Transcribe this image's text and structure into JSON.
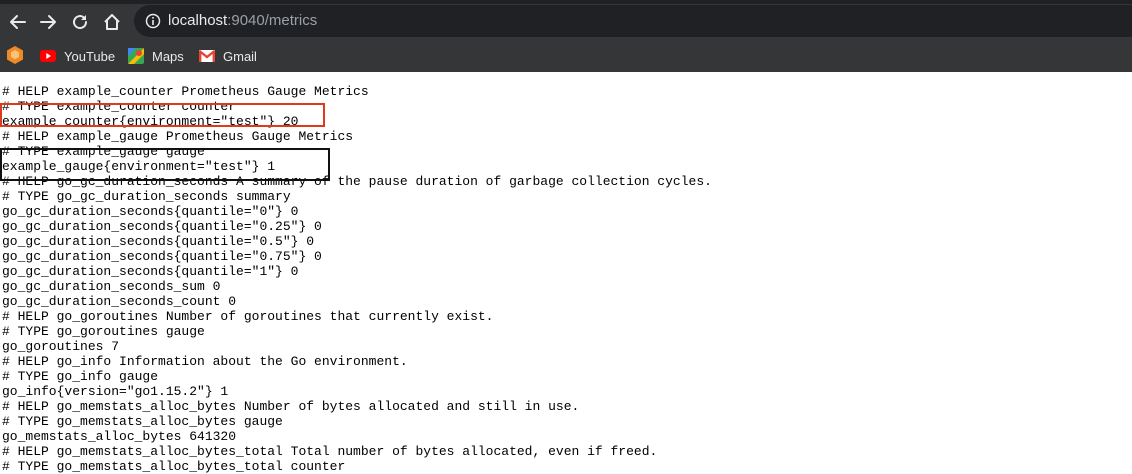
{
  "browser": {
    "url_host": "localhost",
    "url_rest": ":9040/metrics"
  },
  "bookmarks": [
    {
      "label": "YouTube",
      "icon": "youtube-icon"
    },
    {
      "label": "Maps",
      "icon": "maps-icon"
    },
    {
      "label": "Gmail",
      "icon": "gmail-icon"
    }
  ],
  "colors": {
    "highlight_red": "#e03a1e",
    "highlight_black": "#111111"
  },
  "metrics_lines": [
    "# HELP example_counter Prometheus Gauge Metrics",
    "# TYPE example_counter counter",
    "example_counter{environment=\"test\"} 20",
    "# HELP example_gauge Prometheus Gauge Metrics",
    "# TYPE example_gauge gauge",
    "example_gauge{environment=\"test\"} 1",
    "# HELP go_gc_duration_seconds A summary of the pause duration of garbage collection cycles.",
    "# TYPE go_gc_duration_seconds summary",
    "go_gc_duration_seconds{quantile=\"0\"} 0",
    "go_gc_duration_seconds{quantile=\"0.25\"} 0",
    "go_gc_duration_seconds{quantile=\"0.5\"} 0",
    "go_gc_duration_seconds{quantile=\"0.75\"} 0",
    "go_gc_duration_seconds{quantile=\"1\"} 0",
    "go_gc_duration_seconds_sum 0",
    "go_gc_duration_seconds_count 0",
    "# HELP go_goroutines Number of goroutines that currently exist.",
    "# TYPE go_goroutines gauge",
    "go_goroutines 7",
    "# HELP go_info Information about the Go environment.",
    "# TYPE go_info gauge",
    "go_info{version=\"go1.15.2\"} 1",
    "# HELP go_memstats_alloc_bytes Number of bytes allocated and still in use.",
    "# TYPE go_memstats_alloc_bytes gauge",
    "go_memstats_alloc_bytes 641320",
    "# HELP go_memstats_alloc_bytes_total Total number of bytes allocated, even if freed.",
    "# TYPE go_memstats_alloc_bytes_total counter"
  ]
}
